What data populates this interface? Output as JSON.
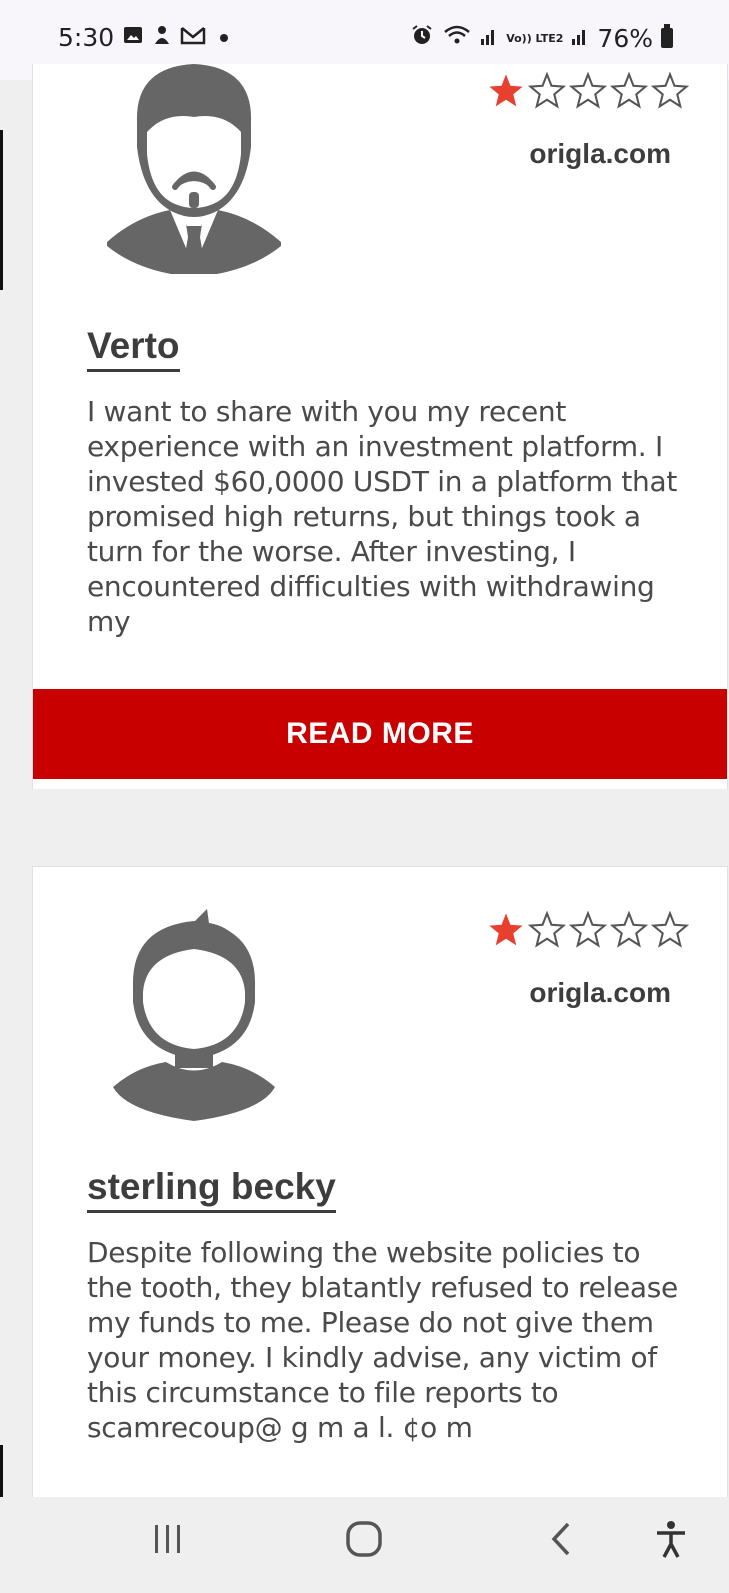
{
  "status": {
    "time": "5:30",
    "battery": "76%",
    "left_icons": [
      "image-icon",
      "person-icon",
      "gmail-icon",
      "notification-dot"
    ],
    "right_icons": [
      "alarm-icon",
      "wifi-icon",
      "signal-icon",
      "volte-lte2-icon",
      "signal-icon",
      "battery-icon"
    ],
    "volte_label": "Vo)) LTE2"
  },
  "reviews": [
    {
      "avatar": "man-with-beard-and-tie-avatar",
      "rating": 1,
      "rating_max": 5,
      "site": "origla.com",
      "name": "Verto",
      "text": "I want to share with you my recent experience with an investment platform. I invested $60,0000 USDT in a platform that promised high returns, but things took a turn for the worse. After investing, I encountered difficulties with withdrawing my",
      "button": "READ MORE"
    },
    {
      "avatar": "man-with-quiff-avatar",
      "rating": 1,
      "rating_max": 5,
      "site": "origla.com",
      "name": "sterling becky",
      "text": "Despite following the website policies to the tooth, they blatantly refused to release my funds to me. Please do not give them your money. I kindly advise, any victim of this circumstance to file reports to scamrecoup@ g m a l. ¢o m"
    }
  ],
  "colors": {
    "accent": "#c80000",
    "star_filled": "#e8402f",
    "star_empty": "#555555",
    "text": "#3d3d3d",
    "background": "#efefef"
  },
  "nav": [
    "recent-apps-icon",
    "home-icon",
    "back-icon",
    "accessibility-icon"
  ]
}
